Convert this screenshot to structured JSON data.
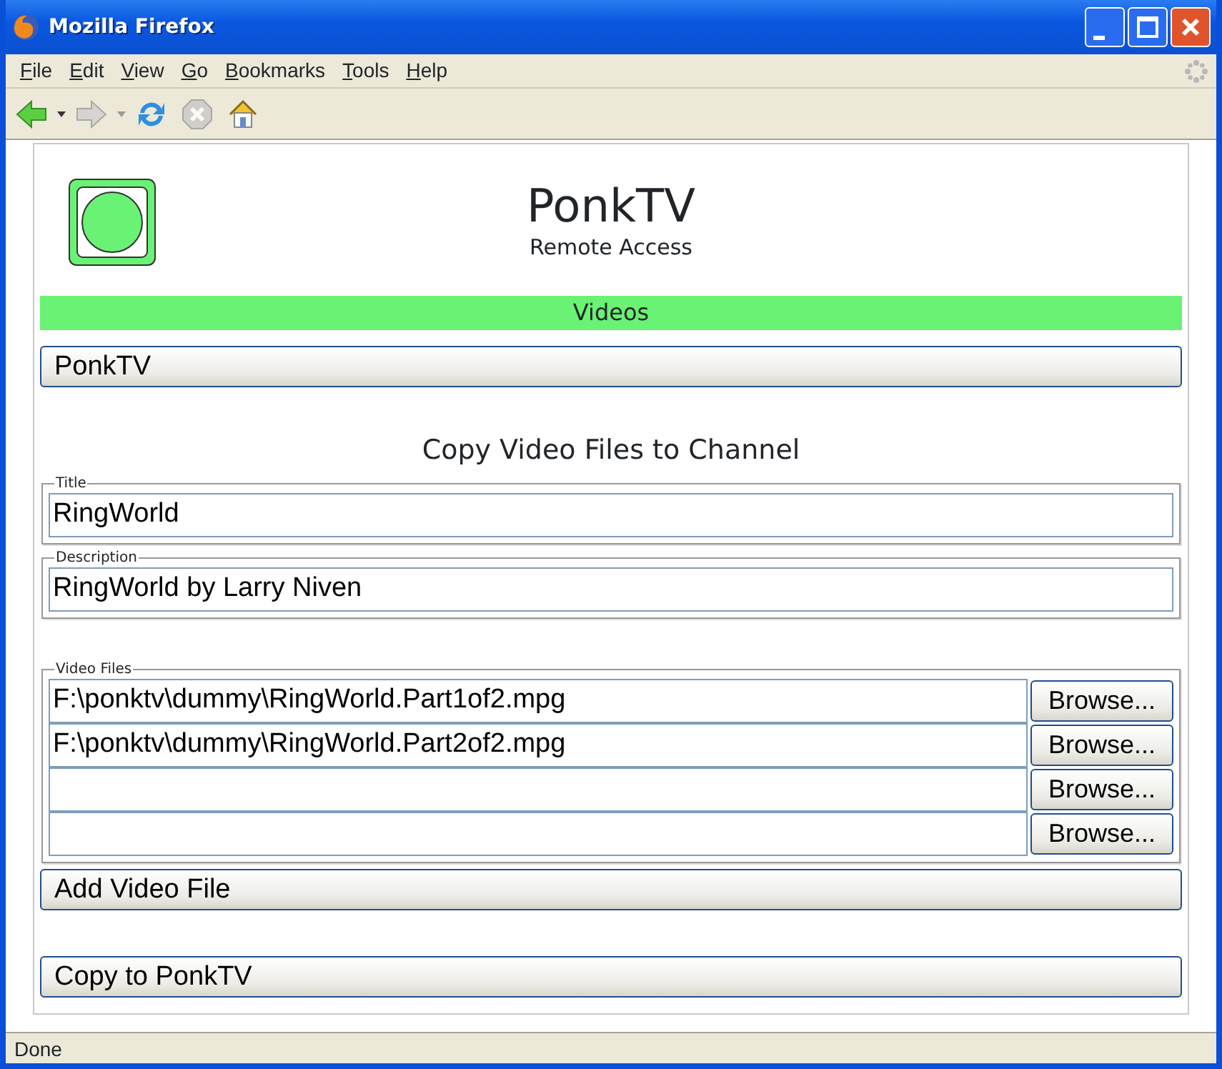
{
  "window": {
    "title": "Mozilla Firefox"
  },
  "menu": [
    "File",
    "Edit",
    "View",
    "Go",
    "Bookmarks",
    "Tools",
    "Help"
  ],
  "toolbar": [
    {
      "kind": "back",
      "disabled": false
    },
    {
      "kind": "forward",
      "disabled": true
    },
    {
      "kind": "reload",
      "disabled": false
    },
    {
      "kind": "stop",
      "disabled": true
    },
    {
      "kind": "home",
      "disabled": false
    }
  ],
  "page": {
    "app_title": "PonkTV",
    "subtitle": "Remote Access",
    "section": "Videos",
    "channel_button": "PonkTV",
    "form_title": "Copy Video Files to Channel",
    "fields": [
      {
        "legend": "Title",
        "value": "RingWorld"
      },
      {
        "legend": "Description",
        "value": "RingWorld by Larry Niven"
      }
    ],
    "video_files": {
      "legend": "Video Files",
      "rows": [
        {
          "value": "F:\\ponktv\\dummy\\RingWorld.Part1of2.mpg",
          "button": "Browse..."
        },
        {
          "value": "F:\\ponktv\\dummy\\RingWorld.Part2of2.mpg",
          "button": "Browse..."
        },
        {
          "button": "Browse..."
        },
        {
          "button": "Browse..."
        }
      ]
    },
    "add_button": "Add Video File",
    "submit_button": "Copy to PonkTV"
  },
  "status_bar": "Done"
}
